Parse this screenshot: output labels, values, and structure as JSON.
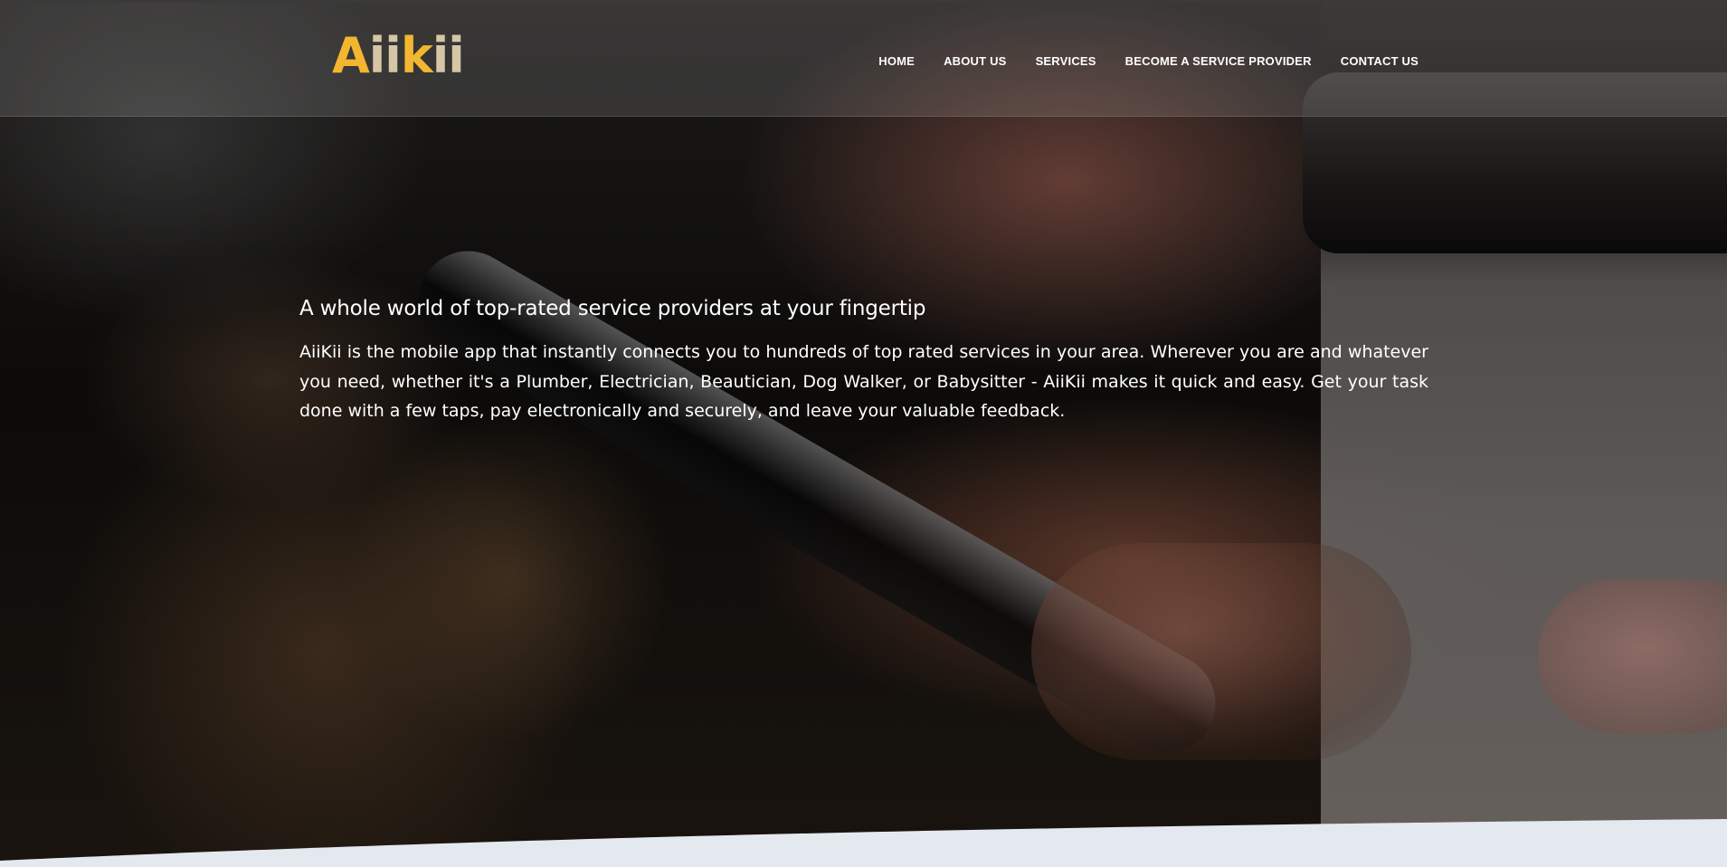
{
  "brand": {
    "logo_part1": "Aiik",
    "logo_part2": "ii",
    "logo_part1_colors": {
      "A": "#f3b630",
      "ii": "#d6c6a6",
      "k": "#f3b630"
    },
    "logo_A": "A",
    "logo_ii_1": "ii",
    "logo_k": "k",
    "logo_ii_2": "ii"
  },
  "nav": {
    "items": [
      {
        "label": "HOME"
      },
      {
        "label": "ABOUT US"
      },
      {
        "label": "SERVICES"
      },
      {
        "label": "BECOME A SERVICE PROVIDER"
      },
      {
        "label": "CONTACT US"
      }
    ]
  },
  "hero": {
    "title": "A whole world of top-rated service providers at your fingertip",
    "text": "AiiKii is the mobile app that instantly connects you to hundreds of top rated services in your area. Wherever you are and whatever you need, whether it's a Plumber, Electrician, Beautician, Dog Walker, or Babysitter - AiiKii makes it quick and easy. Get your task done with a few taps, pay electronically and securely, and leave your valuable feedback."
  },
  "colors": {
    "accent": "#f3b630",
    "logo_secondary": "#d6c6a6",
    "wave_bottom": "#e4e8ef"
  }
}
